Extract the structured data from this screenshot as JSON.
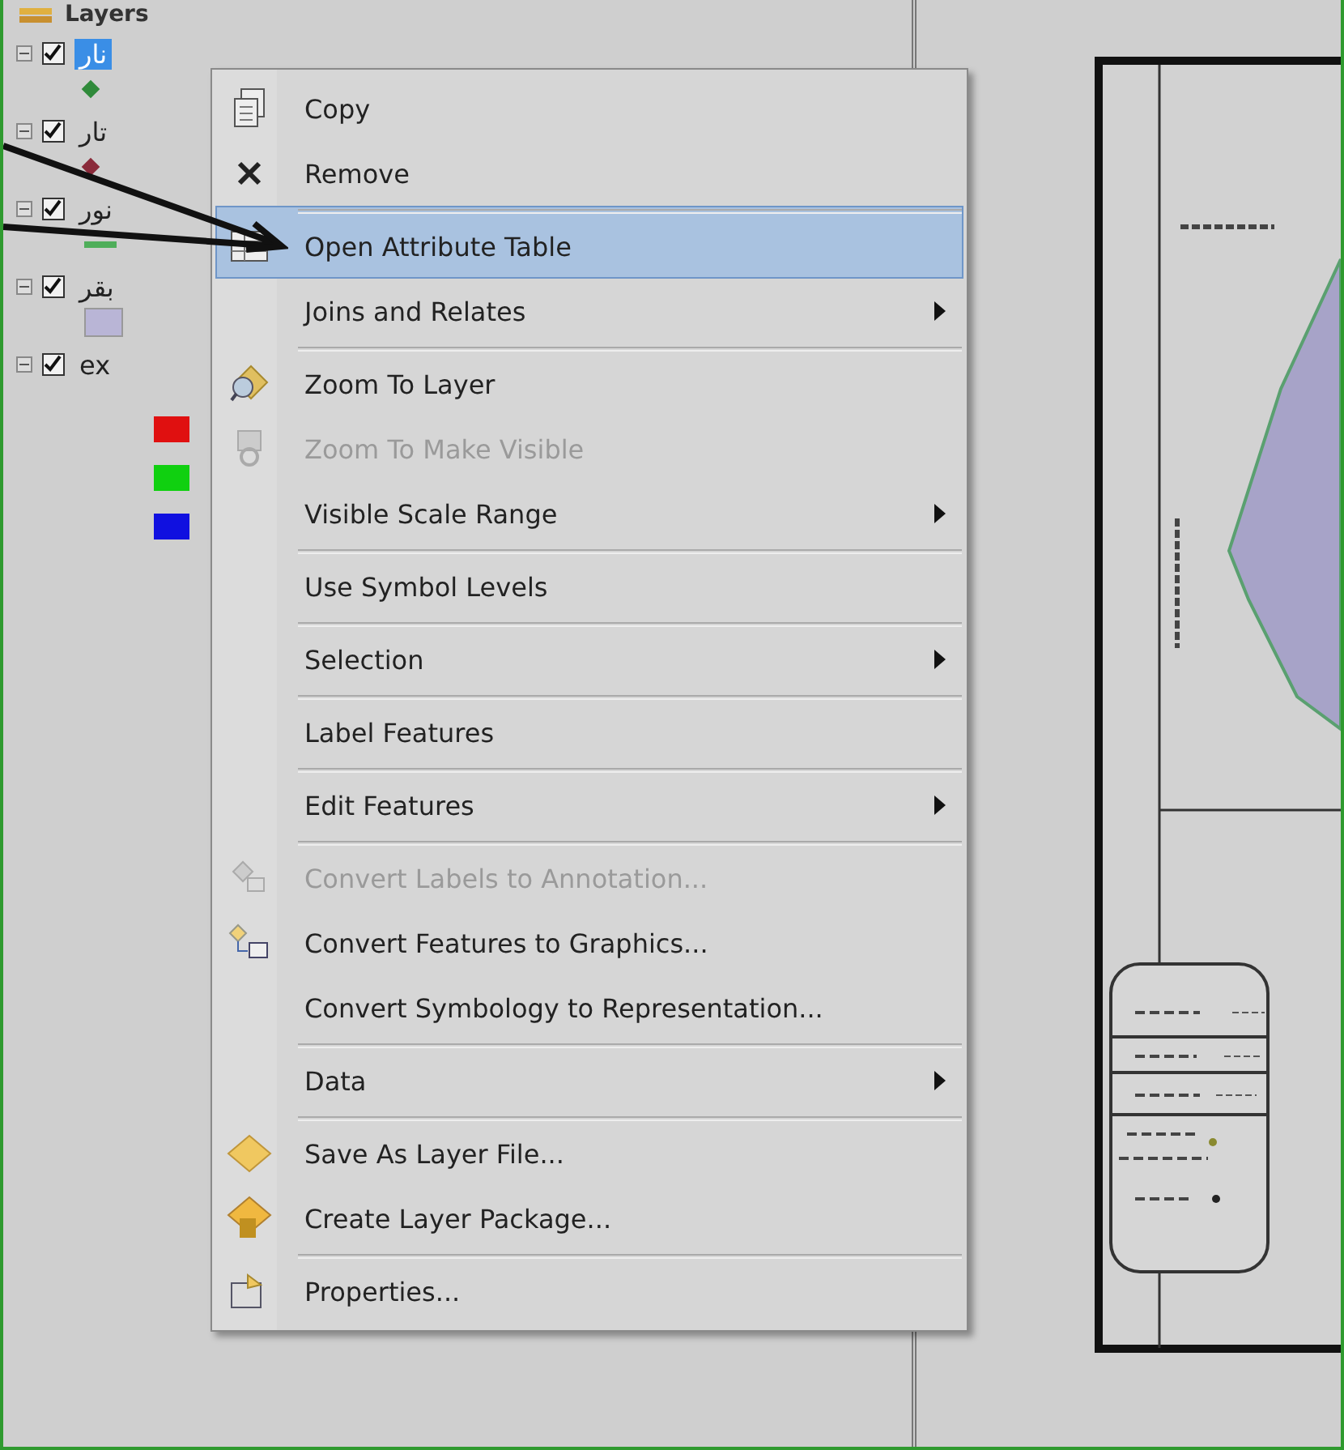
{
  "toc": {
    "title": "Layers",
    "layers": [
      {
        "name": "نار",
        "checked": true,
        "selected": true,
        "expanded": true,
        "symbol": {
          "kind": "dot",
          "color": "#2f8a3a"
        }
      },
      {
        "name": "تار",
        "checked": true,
        "selected": false,
        "expanded": true,
        "symbol": {
          "kind": "dot",
          "color": "#8a2a3a"
        }
      },
      {
        "name": "نور",
        "checked": true,
        "selected": false,
        "expanded": true,
        "symbol": {
          "kind": "line",
          "color": "#4fae5a"
        }
      },
      {
        "name": "بقر",
        "checked": true,
        "selected": false,
        "expanded": true,
        "symbol": {
          "kind": "fill",
          "color": "#b9b5d6"
        }
      },
      {
        "name": "ex",
        "checked": true,
        "selected": false,
        "expanded": true,
        "classes": [
          {
            "color": "#e01010"
          },
          {
            "color": "#10d010"
          },
          {
            "color": "#1010e0"
          }
        ]
      }
    ]
  },
  "context_menu": {
    "items": [
      {
        "label": "Copy",
        "selected": false,
        "disabled": false,
        "submenu": false,
        "separator_before": false
      },
      {
        "label": "Remove",
        "selected": false,
        "disabled": false,
        "submenu": false,
        "separator_before": false
      },
      {
        "label": "Open Attribute Table",
        "selected": true,
        "disabled": false,
        "submenu": false,
        "separator_before": true
      },
      {
        "label": "Joins and Relates",
        "selected": false,
        "disabled": false,
        "submenu": true,
        "separator_before": false
      },
      {
        "label": "Zoom To Layer",
        "selected": false,
        "disabled": false,
        "submenu": false,
        "separator_before": true
      },
      {
        "label": "Zoom To Make Visible",
        "selected": false,
        "disabled": true,
        "submenu": false,
        "separator_before": false
      },
      {
        "label": "Visible Scale Range",
        "selected": false,
        "disabled": false,
        "submenu": true,
        "separator_before": false
      },
      {
        "label": "Use Symbol Levels",
        "selected": false,
        "disabled": false,
        "submenu": false,
        "separator_before": true
      },
      {
        "label": "Selection",
        "selected": false,
        "disabled": false,
        "submenu": true,
        "separator_before": true
      },
      {
        "label": "Label Features",
        "selected": false,
        "disabled": false,
        "submenu": false,
        "separator_before": true
      },
      {
        "label": "Edit Features",
        "selected": false,
        "disabled": false,
        "submenu": true,
        "separator_before": true
      },
      {
        "label": "Convert Labels to Annotation...",
        "selected": false,
        "disabled": true,
        "submenu": false,
        "separator_before": true
      },
      {
        "label": "Convert Features to Graphics...",
        "selected": false,
        "disabled": false,
        "submenu": false,
        "separator_before": false
      },
      {
        "label": "Convert Symbology to Representation...",
        "selected": false,
        "disabled": false,
        "submenu": false,
        "separator_before": false
      },
      {
        "label": "Data",
        "selected": false,
        "disabled": false,
        "submenu": true,
        "separator_before": true
      },
      {
        "label": "Save As Layer File...",
        "selected": false,
        "disabled": false,
        "submenu": false,
        "separator_before": true
      },
      {
        "label": "Create Layer Package...",
        "selected": false,
        "disabled": false,
        "submenu": false,
        "separator_before": false
      },
      {
        "label": "Properties...",
        "selected": false,
        "disabled": false,
        "submenu": false,
        "separator_before": true
      }
    ]
  }
}
